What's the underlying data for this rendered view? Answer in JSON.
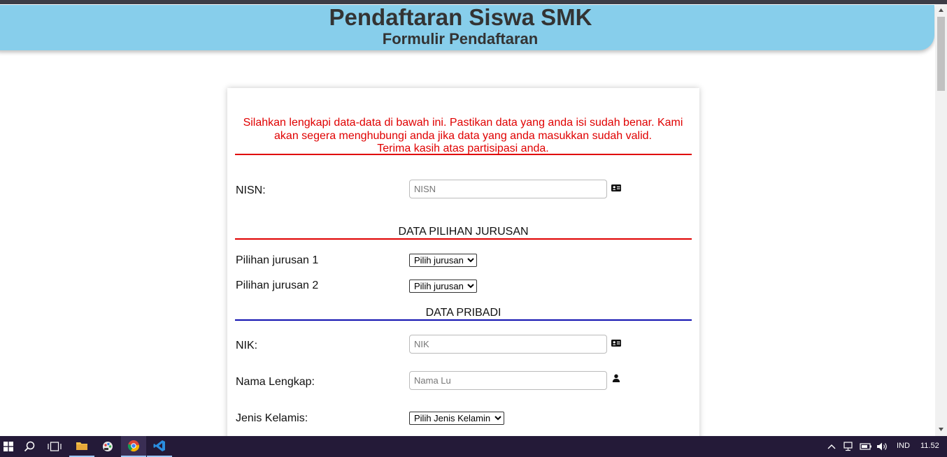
{
  "header": {
    "title": "Pendaftaran Siswa SMK",
    "subtitle": "Formulir Pendaftaran"
  },
  "intro": {
    "line1": "Silahkan lengkapi data-data di bawah ini. Pastikan data yang anda isi sudah benar. Kami",
    "line2": "akan segera menghubungi anda jika data yang anda masukkan sudah valid.",
    "line3": "Terima kasih atas partisipasi anda."
  },
  "fields": {
    "nisn": {
      "label": "NISN:",
      "placeholder": "NISN",
      "icon": "id-card-icon"
    },
    "nik": {
      "label": "NIK:",
      "placeholder": "NIK",
      "icon": "id-card-icon"
    },
    "nama": {
      "label": "Nama Lengkap:",
      "placeholder": "Nama Lu",
      "icon": "person-icon"
    },
    "jurusan1": {
      "label": "Pilihan jurusan 1",
      "selected": "Pilih jurusan"
    },
    "jurusan2": {
      "label": "Pilihan jurusan 2",
      "selected": "Pilih jurusan"
    },
    "kelamin": {
      "label": "Jenis Kelamis:",
      "selected": "Pilih Jenis Kelamin"
    }
  },
  "sections": {
    "jurusan": "DATA PILIHAN JURUSAN",
    "pribadi": "DATA PRIBADI"
  },
  "colors": {
    "header_bg": "#87ceeb",
    "intro_text": "#e00000",
    "rule_red": "#e00000",
    "rule_blue": "#1010b0"
  },
  "taskbar": {
    "language": "IND",
    "time": "11.52"
  }
}
